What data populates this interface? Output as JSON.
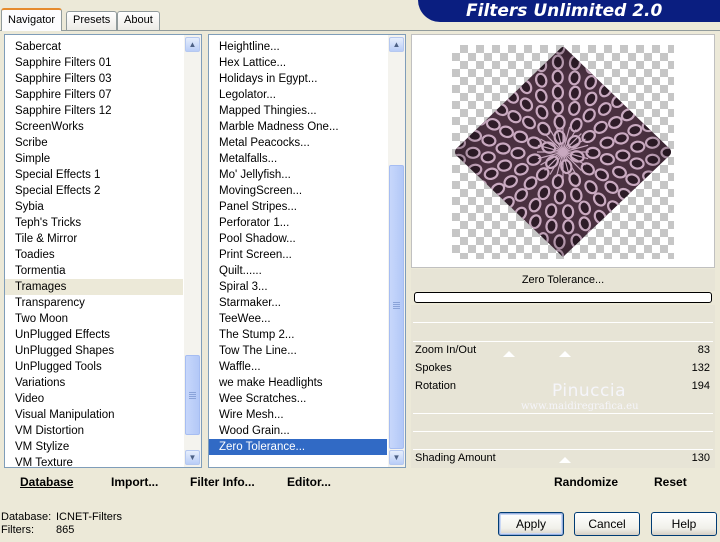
{
  "window": {
    "title": "Filters Unlimited 2.0"
  },
  "tabs": [
    {
      "label": "Navigator",
      "active": true
    },
    {
      "label": "Presets",
      "active": false
    },
    {
      "label": "About",
      "active": false
    }
  ],
  "categories": {
    "items": [
      "Sabercat",
      "Sapphire Filters 01",
      "Sapphire Filters 03",
      "Sapphire Filters 07",
      "Sapphire Filters 12",
      "ScreenWorks",
      "Scribe",
      "Simple",
      "Special Effects 1",
      "Special Effects 2",
      "Sybia",
      "Teph's Tricks",
      "Tile & Mirror",
      "Toadies",
      "Tormentia",
      "Tramages",
      "Transparency",
      "Two Moon",
      "UnPlugged Effects",
      "UnPlugged Shapes",
      "UnPlugged Tools",
      "Variations",
      "Video",
      "Visual Manipulation",
      "VM Distortion",
      "VM Stylize",
      "VM Texture"
    ],
    "selected": "Tramages"
  },
  "filters": {
    "items": [
      "Heightline...",
      "Hex Lattice...",
      "Holidays in Egypt...",
      "Legolator...",
      "Mapped Thingies...",
      "Marble Madness One...",
      "Metal Peacocks...",
      "Metalfalls...",
      "Mo' Jellyfish...",
      "MovingScreen...",
      "Panel Stripes...",
      "Perforator 1...",
      "Pool Shadow...",
      "Print Screen...",
      "Quilt......",
      "Spiral 3...",
      "Starmaker...",
      "TeeWee...",
      "The Stump 2...",
      "Tow The Line...",
      "Waffle...",
      "we make Headlights",
      "Wee Scratches...",
      "Wire Mesh...",
      "Wood Grain...",
      "Zero Tolerance..."
    ],
    "selected": "Zero Tolerance..."
  },
  "preview": {
    "filter_name": "Zero Tolerance...",
    "pattern_colors": {
      "base": "#4a3040",
      "ring": "#c9a9c0",
      "dark": "#2e1c28"
    }
  },
  "controls": [
    {
      "label": "Zoom In/Out",
      "value": "83"
    },
    {
      "label": "Spokes",
      "value": "132"
    },
    {
      "label": "Rotation",
      "value": "194"
    },
    {
      "label": "Shading Amount",
      "value": "130"
    }
  ],
  "watermark": {
    "name": "Pinuccia",
    "url": "www.maidiregrafica.eu"
  },
  "bottom_buttons": {
    "database": "Database",
    "import": "Import...",
    "filter_info": "Filter Info...",
    "editor": "Editor...",
    "randomize": "Randomize",
    "reset": "Reset"
  },
  "status": {
    "database_label": "Database:",
    "database_value": "ICNET-Filters",
    "filters_label": "Filters:",
    "filters_value": "865"
  },
  "dialog_buttons": {
    "apply": "Apply",
    "cancel": "Cancel",
    "help": "Help"
  }
}
